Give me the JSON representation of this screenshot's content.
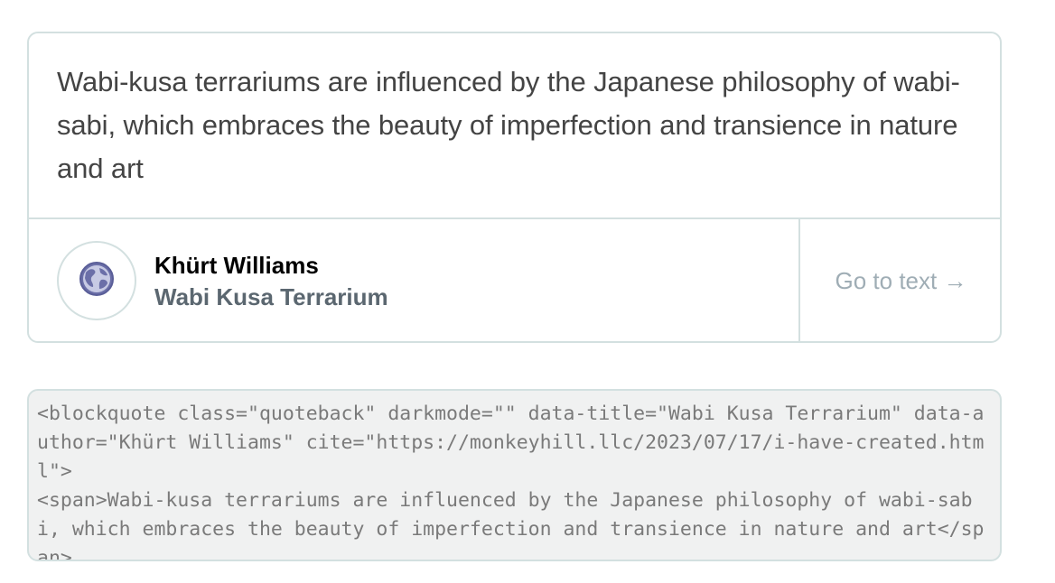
{
  "quote": {
    "text": "Wabi-kusa terrariums are influenced by the Japanese philosophy of wabi-sabi, which embraces the beauty of imperfection and transience in nature and art",
    "author": "Khürt Williams",
    "source_title": "Wabi Kusa Terrarium",
    "link_label": "Go to text →",
    "avatar_icon": "globe-icon"
  },
  "embed_code": {
    "text": "<blockquote class=\"quoteback\" darkmode=\"\" data-title=\"Wabi Kusa Terrarium\" data-author=\"Khürt Williams\" cite=\"https://monkeyhill.llc/2023/07/17/i-have-created.html\">\n<span>Wabi-kusa terrariums are influenced by the Japanese philosophy of wabi-sabi, which embraces the beauty of imperfection and transience in nature and art</span>"
  },
  "colors": {
    "border": "#d3e0e0",
    "quote_text": "#444444",
    "author": "#000000",
    "source": "#5b6770",
    "link": "#9fadb5",
    "code_bg": "#f0f1f1",
    "globe": "#6b6fa8"
  }
}
